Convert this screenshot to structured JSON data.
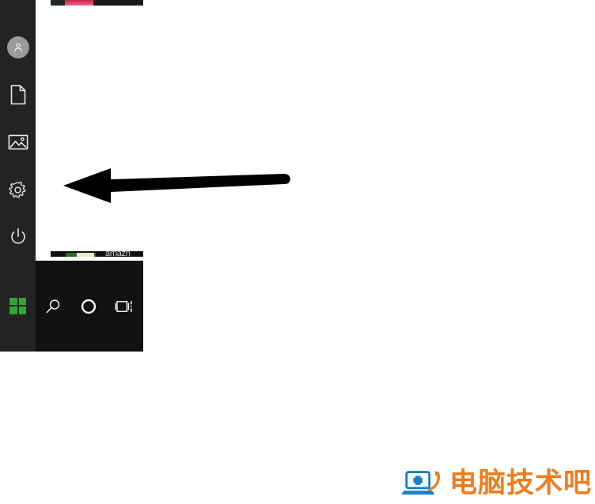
{
  "window": {
    "os": "Windows 10",
    "surface": "start-menu"
  },
  "start_menu": {
    "rail": {
      "items": [
        {
          "id": "user",
          "icon": "user-avatar-icon",
          "label": "User account"
        },
        {
          "id": "documents",
          "icon": "document-icon",
          "label": "Documents"
        },
        {
          "id": "pictures",
          "icon": "pictures-icon",
          "label": "Pictures"
        },
        {
          "id": "settings",
          "icon": "gear-icon",
          "label": "Settings"
        },
        {
          "id": "power",
          "icon": "power-icon",
          "label": "Power"
        }
      ]
    },
    "tiles": {
      "top_fragment_color": "#e8456e",
      "bottom_fragment_label": "amazn",
      "bottom_fragment_colors": [
        "#2f6b22",
        "#ece8c2"
      ]
    },
    "panel_background": "#ffffff"
  },
  "taskbar": {
    "background": "#111111",
    "buttons": [
      {
        "id": "start",
        "icon": "windows-logo-icon",
        "label": "Start",
        "color": "#2fa82f"
      },
      {
        "id": "search",
        "icon": "search-icon",
        "label": "Search"
      },
      {
        "id": "cortana",
        "icon": "cortana-circle-icon",
        "label": "Cortana"
      },
      {
        "id": "taskview",
        "icon": "task-view-icon",
        "label": "Task View"
      }
    ]
  },
  "annotation": {
    "arrow": {
      "direction": "left",
      "color": "#000000",
      "points_to": "start-menu-left-rail"
    }
  },
  "watermark": {
    "text": "电脑技术吧",
    "color": "#f07c1a",
    "icon": "laptop-plus-icon"
  }
}
